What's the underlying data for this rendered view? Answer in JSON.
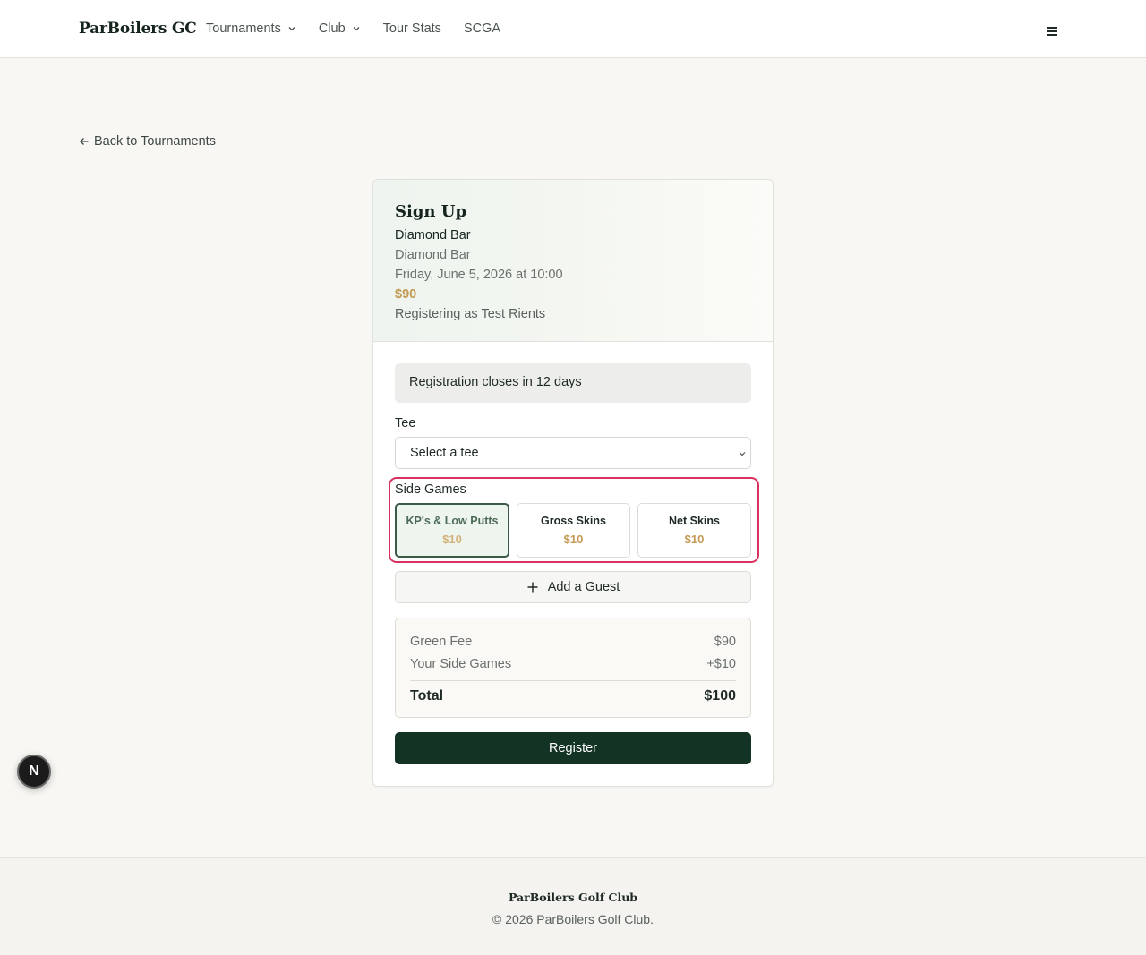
{
  "header": {
    "brand": "ParBoilers GC",
    "nav": [
      {
        "label": "Tournaments",
        "has_dropdown": true
      },
      {
        "label": "Club",
        "has_dropdown": true
      },
      {
        "label": "Tour Stats",
        "has_dropdown": false
      },
      {
        "label": "SCGA",
        "has_dropdown": false
      }
    ],
    "menu_icon": "hamburger-icon"
  },
  "back_link": {
    "label": "Back to Tournaments",
    "icon": "arrow-left-icon"
  },
  "signup": {
    "title": "Sign Up",
    "course": "Diamond Bar",
    "location": "Diamond Bar",
    "datetime": "Friday, June 5, 2026 at 10:00",
    "price": "$90",
    "registering_as": "Registering as Test Rients",
    "notice": "Registration closes in 12 days",
    "tee_label": "Tee",
    "tee_selected": "Select a tee",
    "side_games_label": "Side Games",
    "side_games": [
      {
        "name": "KP's & Low Putts",
        "price": "$10",
        "selected": true
      },
      {
        "name": "Gross Skins",
        "price": "$10",
        "selected": false
      },
      {
        "name": "Net Skins",
        "price": "$10",
        "selected": false
      }
    ],
    "add_guest_label": "Add a Guest",
    "summary": {
      "green_fee_label": "Green Fee",
      "green_fee_value": "$90",
      "side_games_label": "Your Side Games",
      "side_games_value": "+$10",
      "total_label": "Total",
      "total_value": "$100"
    },
    "register_label": "Register"
  },
  "badge": {
    "letter": "N"
  },
  "footer": {
    "brand": "ParBoilers Golf Club",
    "copyright": "© 2026 ParBoilers Golf Club."
  },
  "colors": {
    "accent_dark_green": "#133424",
    "price_gold": "#c49a54",
    "highlight_red": "#d9325f",
    "selected_bg": "#eef5ef"
  }
}
